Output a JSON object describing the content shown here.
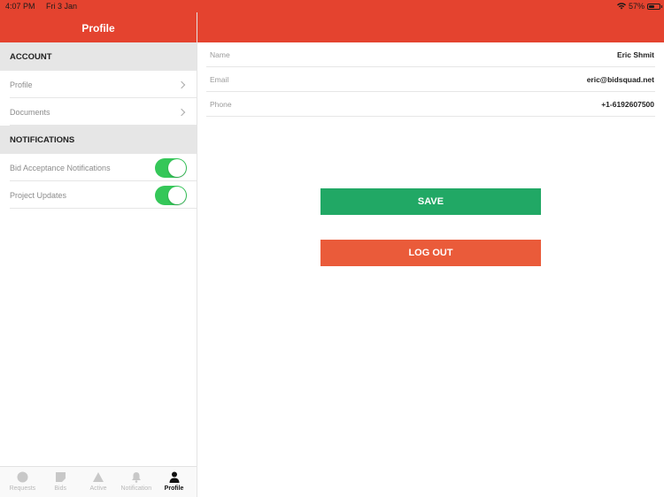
{
  "status_bar": {
    "time": "4:07 PM",
    "date": "Fri 3 Jan",
    "battery": "57%",
    "battery_level": 0.57
  },
  "sidebar": {
    "title": "Profile",
    "sections": [
      {
        "header": "ACCOUNT",
        "items": [
          {
            "label": "Profile"
          },
          {
            "label": "Documents"
          }
        ]
      },
      {
        "header": "NOTIFICATIONS",
        "items": [
          {
            "label": "Bid Acceptance Notifications",
            "enabled": true
          },
          {
            "label": "Project Updates",
            "enabled": true
          }
        ]
      }
    ]
  },
  "detail": {
    "fields": [
      {
        "label": "Name",
        "value": "Eric Shmit"
      },
      {
        "label": "Email",
        "value": "eric@bidsquad.net"
      },
      {
        "label": "Phone",
        "value": "+1-6192607500"
      }
    ],
    "save_label": "SAVE",
    "logout_label": "LOG OUT"
  },
  "tabbar": {
    "tabs": [
      {
        "label": "Requests",
        "icon": "circle-icon"
      },
      {
        "label": "Bids",
        "icon": "chat-bubble-icon"
      },
      {
        "label": "Active",
        "icon": "triangle-icon"
      },
      {
        "label": "Notification",
        "icon": "bell-icon"
      },
      {
        "label": "Profile",
        "icon": "person-icon",
        "active": true
      }
    ]
  },
  "colors": {
    "brand": "#e4432f",
    "save": "#21a865",
    "logout": "#ea5b3a",
    "toggle_on": "#35c759"
  }
}
